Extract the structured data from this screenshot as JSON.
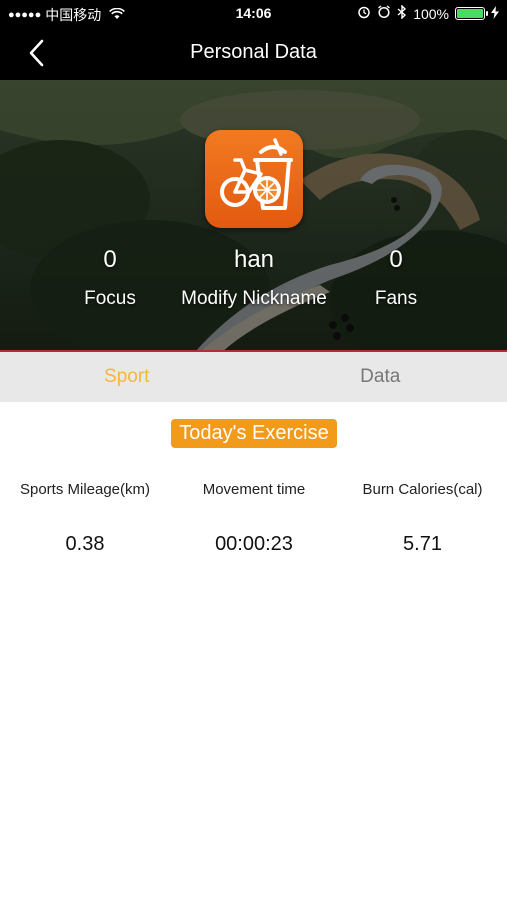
{
  "status_bar": {
    "signal_dots": "●●●●●",
    "carrier": "中国移动",
    "time": "14:06",
    "battery": "100%",
    "battery_level": 1.0,
    "icons": [
      "wifi-icon",
      "alarm-icon",
      "bluetooth-icon",
      "battery-icon",
      "charging-icon"
    ]
  },
  "nav": {
    "title": "Personal Data",
    "back_icon": "chevron-left-icon"
  },
  "profile": {
    "focus_count": "0",
    "focus_label": "Focus",
    "nickname": "han",
    "nickname_label": "Modify Nickname",
    "fans_count": "0",
    "fans_label": "Fans",
    "app_icon": "bicycle-juice-app-icon"
  },
  "tabs": [
    {
      "label": "Sport",
      "active": true
    },
    {
      "label": "Data",
      "active": false
    }
  ],
  "exercise": {
    "title": "Today's Exercise",
    "metrics": [
      {
        "label": "Sports Mileage(km)",
        "value": "0.38"
      },
      {
        "label": "Movement time",
        "value": "00:00:23"
      },
      {
        "label": "Burn Calories(cal)",
        "value": "5.71"
      }
    ]
  },
  "colors": {
    "accent": "#f29a1a",
    "active_tab": "#f5b73b",
    "inactive_tab": "#777777",
    "tab_bg": "#e8e8e8",
    "bar_bg": "#000000"
  }
}
